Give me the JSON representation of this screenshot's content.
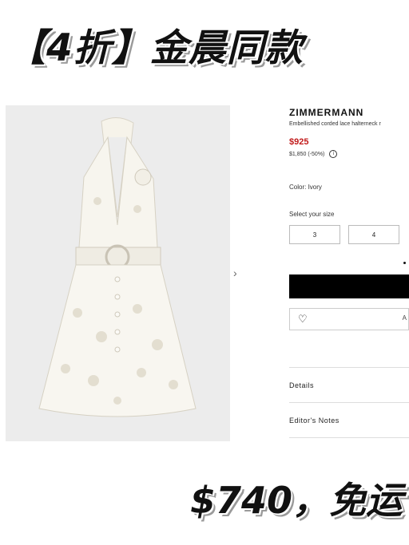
{
  "banner": {
    "text": "【4折】金晨同款"
  },
  "footer": {
    "text": "$740，免运"
  },
  "product": {
    "brand": "ZIMMERMANN",
    "description": "Embellished corded lace halterneck r",
    "sale_price": "$925",
    "original_price": "$1,850",
    "discount": "(-50%)",
    "info_icon": "i",
    "color": "Color: Ivory",
    "size_label": "Select your size",
    "sizes": [
      "3",
      "4"
    ],
    "wishlist_partial": "A",
    "sections": [
      "Details",
      "Editor's Notes"
    ]
  },
  "gallery": {
    "next_arrow": "›"
  },
  "colors": {
    "accent_price": "#c11a1a",
    "button_bg": "#000000",
    "image_bg": "#ececec"
  }
}
